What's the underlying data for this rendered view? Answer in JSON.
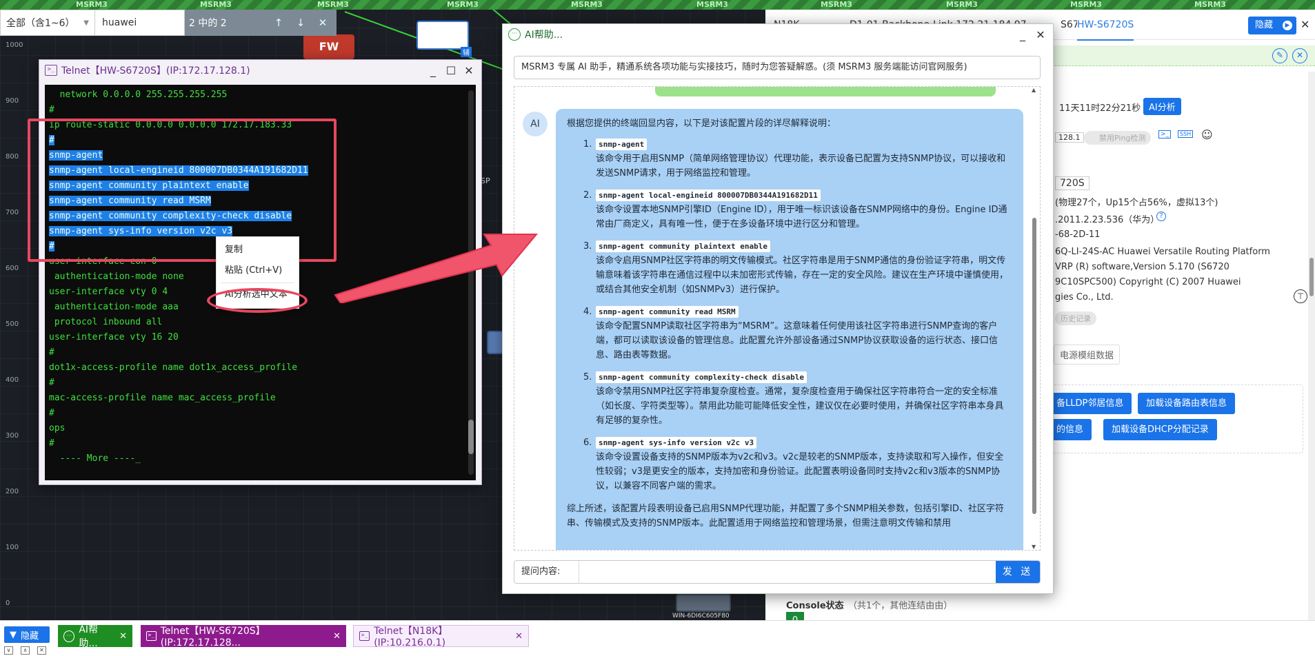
{
  "app": {
    "banner_text": "MSRM3"
  },
  "canvas": {
    "y_labels": [
      "1000",
      "900",
      "800",
      "700",
      "600",
      "500",
      "400",
      "300",
      "200",
      "100",
      "0"
    ],
    "node_labels": [
      "SP",
      "辅"
    ],
    "fw_label": "FW",
    "bottom_device_label": "WIN-6DI6C605F80"
  },
  "search": {
    "scope_label": "全部（含1~6）",
    "query": "huawei",
    "match_label": "2 中的 2",
    "prev_icon": "arrow-up-icon",
    "next_icon": "arrow-down-icon",
    "close_icon": "close-icon"
  },
  "telnet_window": {
    "title": "Telnet【HW-S6720S】(IP:172.17.128.1)",
    "lines": [
      {
        "text": "  network 0.0.0.0 255.255.255.255",
        "selected": false
      },
      {
        "text": "#",
        "selected": false
      },
      {
        "text": "ip route-static 0.0.0.0 0.0.0.0 172.17.183.33",
        "selected": false
      },
      {
        "text": "#",
        "selected": true
      },
      {
        "text": "snmp-agent",
        "selected": true
      },
      {
        "text": "snmp-agent local-engineid 800007DB0344A191682D11",
        "selected": true
      },
      {
        "text": "snmp-agent community plaintext enable",
        "selected": true
      },
      {
        "text": "snmp-agent community read MSRM",
        "selected": true
      },
      {
        "text": "snmp-agent community complexity-check disable",
        "selected": true
      },
      {
        "text": "snmp-agent sys-info version v2c v3",
        "selected": true
      },
      {
        "text": "#",
        "selected": true
      },
      {
        "text": "user-interface con 0",
        "selected": false
      },
      {
        "text": " authentication-mode none",
        "selected": false
      },
      {
        "text": "user-interface vty 0 4",
        "selected": false
      },
      {
        "text": " authentication-mode aaa",
        "selected": false
      },
      {
        "text": " protocol inbound all",
        "selected": false
      },
      {
        "text": "user-interface vty 16 20",
        "selected": false
      },
      {
        "text": "#",
        "selected": false
      },
      {
        "text": "dot1x-access-profile name dot1x_access_profile",
        "selected": false
      },
      {
        "text": "#",
        "selected": false
      },
      {
        "text": "mac-access-profile name mac_access_profile",
        "selected": false
      },
      {
        "text": "#",
        "selected": false
      },
      {
        "text": "ops",
        "selected": false
      },
      {
        "text": "#",
        "selected": false
      },
      {
        "text": "  ---- More ----_",
        "selected": false
      }
    ]
  },
  "context_menu": {
    "copy": "复制",
    "paste": "粘贴 (Ctrl+V)",
    "ai_analyze": "AI分析选中文本"
  },
  "ai_window": {
    "title": "AI帮助...",
    "description": "MSRM3 专属 AI 助手，精通系统各项功能与实接技巧，随时为您答疑解惑。(须 MSRM3 服务端能访问官网服务)",
    "avatar": "AI",
    "intro": "根据您提供的终端回显内容，以下是对该配置片段的详尽解释说明：",
    "items": [
      {
        "num": "1.",
        "cmd": "snmp-agent",
        "desc": "该命令用于启用SNMP（简单网络管理协议）代理功能，表示设备已配置为支持SNMP协议，可以接收和发送SNMP请求，用于网络监控和管理。"
      },
      {
        "num": "2.",
        "cmd": "snmp-agent local-engineid 800007DB0344A191682D11",
        "desc": "该命令设置本地SNMP引擎ID（Engine ID），用于唯一标识该设备在SNMP网络中的身份。Engine ID通常由厂商定义，具有唯一性，便于在多设备环境中进行区分和管理。"
      },
      {
        "num": "3.",
        "cmd": "snmp-agent community plaintext enable",
        "desc": "该命令启用SNMP社区字符串的明文传输模式。社区字符串是用于SNMP通信的身份验证字符串，明文传输意味着该字符串在通信过程中以未加密形式传输，存在一定的安全风险。建议在生产环境中谨慎使用，或结合其他安全机制（如SNMPv3）进行保护。"
      },
      {
        "num": "4.",
        "cmd": "snmp-agent community read MSRM",
        "desc": "该命令配置SNMP读取社区字符串为“MSRM”。这意味着任何使用该社区字符串进行SNMP查询的客户端，都可以读取该设备的管理信息。此配置允许外部设备通过SNMP协议获取设备的运行状态、接口信息、路由表等数据。"
      },
      {
        "num": "5.",
        "cmd": "snmp-agent community complexity-check disable",
        "desc": "该命令禁用SNMP社区字符串复杂度检查。通常，复杂度检查用于确保社区字符串符合一定的安全标准（如长度、字符类型等）。禁用此功能可能降低安全性，建议仅在必要时使用，并确保社区字符串本身具有足够的复杂性。"
      },
      {
        "num": "6.",
        "cmd": "snmp-agent sys-info version v2c v3",
        "desc": "该命令设置设备支持的SNMP版本为v2c和v3。v2c是较老的SNMP版本，支持读取和写入操作，但安全性较弱；v3是更安全的版本，支持加密和身份验证。此配置表明设备同时支持v2c和v3版本的SNMP协议，以兼容不同客户端的需求。"
      }
    ],
    "summary": "综上所述，该配置片段表明设备已启用SNMP代理功能，并配置了多个SNMP相关参数，包括引擎ID、社区字符串、传输模式及支持的SNMP版本。此配置适用于网络监控和管理场景，但需注意明文传输和禁用",
    "ask_label": "提问内容:",
    "ask_placeholder": "",
    "send_label": "发 送"
  },
  "props_panel": {
    "tabs": [
      "N18K",
      "D1-01-Backbone-Link 172.21.184.97",
      "S6720S01",
      "HW-S6720S"
    ],
    "hide_label": "隐藏",
    "uptime": "11天11时22分21秒",
    "ai_analyze": "AI分析",
    "ip_fragment": "128.1",
    "ping_toggle": "禁用Ping检测",
    "model_fragment": "720S",
    "ports_text": "(物理27个，Up15个占56%，虚拟13个)",
    "oid_text": ".2011.2.23.536（华为）",
    "mac_text": "-68-2D-11",
    "sysdesc_lines": [
      "6Q-LI-24S-AC Huawei Versatile Routing Platform",
      "VRP (R) software,Version 5.170 (S6720",
      "9C10SPC500) Copyright (C) 2007 Huawei",
      "gies Co., Ltd."
    ],
    "history_chip": "历史记录",
    "power_chip": "电源模组数据",
    "btn_lldp": "备LLDP邻居信息",
    "btn_route": "加载设备路由表信息",
    "btn_info": "的信息",
    "btn_dhcp": "加载设备DHCP分配记录",
    "console_label": "Console状态",
    "console_note": "（共1个，其他连结由由）",
    "console_count": "0"
  },
  "taskbar": {
    "hide_label": "隐藏",
    "ai_label": "AI帮助...",
    "telnet1_label": "Telnet【HW-S6720S】(IP:172.17.128...",
    "telnet2_label": "Telnet【N18K】(IP:10.216.0.1)"
  },
  "colors": {
    "accent": "#1a73e8",
    "selection": "#1f7fe8",
    "terminal_text": "#3ee03e",
    "highlight": "#e8475f",
    "ai_bubble": "#a9d0f5",
    "telnet_task": "#8e1b8e",
    "ai_task": "#1e8e22"
  }
}
